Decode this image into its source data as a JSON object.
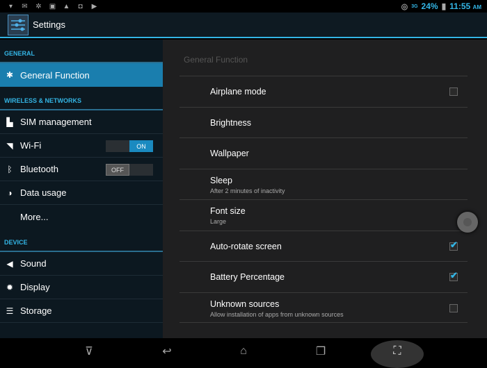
{
  "status_bar": {
    "notification_icons": [
      "wifi-question-icon",
      "gmail-icon",
      "sync-icon",
      "image-icon",
      "warning-icon",
      "shopping-bag-icon",
      "store-icon"
    ],
    "signal_label": "3G",
    "battery_percent": "24%",
    "time": "11:55",
    "ampm": "AM"
  },
  "action_bar": {
    "title": "Settings"
  },
  "sidebar": {
    "sections": [
      {
        "header": "GENERAL",
        "items": [
          {
            "label": "General Function",
            "icon": "gear-icon",
            "selected": true
          }
        ]
      },
      {
        "header": "WIRELESS & NETWORKS",
        "items": [
          {
            "label": "SIM management",
            "icon": "sim-icon"
          },
          {
            "label": "Wi-Fi",
            "icon": "wifi-icon",
            "toggle": "ON"
          },
          {
            "label": "Bluetooth",
            "icon": "bluetooth-icon",
            "toggle": "OFF"
          },
          {
            "label": "Data usage",
            "icon": "data-usage-icon"
          },
          {
            "label": "More...",
            "icon": ""
          }
        ]
      },
      {
        "header": "DEVICE",
        "items": [
          {
            "label": "Sound",
            "icon": "sound-icon"
          },
          {
            "label": "Display",
            "icon": "display-icon"
          },
          {
            "label": "Storage",
            "icon": "storage-icon"
          }
        ]
      }
    ]
  },
  "content": {
    "title": "General Function",
    "rows": [
      {
        "title": "Airplane mode",
        "checkbox": false
      },
      {
        "title": "Brightness"
      },
      {
        "title": "Wallpaper"
      },
      {
        "title": "Sleep",
        "summary": "After 2 minutes of inactivity"
      },
      {
        "title": "Font size",
        "summary": "Large"
      },
      {
        "title": "Auto-rotate screen",
        "checkbox": true
      },
      {
        "title": "Battery Percentage",
        "checkbox": true
      },
      {
        "title": "Unknown sources",
        "summary": "Allow installation of apps from unknown sources",
        "checkbox": false
      }
    ]
  },
  "nav_bar": {
    "buttons": [
      "hide-keyboard-icon",
      "back-icon",
      "home-icon",
      "recents-icon",
      "screenshot-icon"
    ]
  },
  "colors": {
    "accent": "#33b5e5",
    "selected": "#1a7eae"
  }
}
